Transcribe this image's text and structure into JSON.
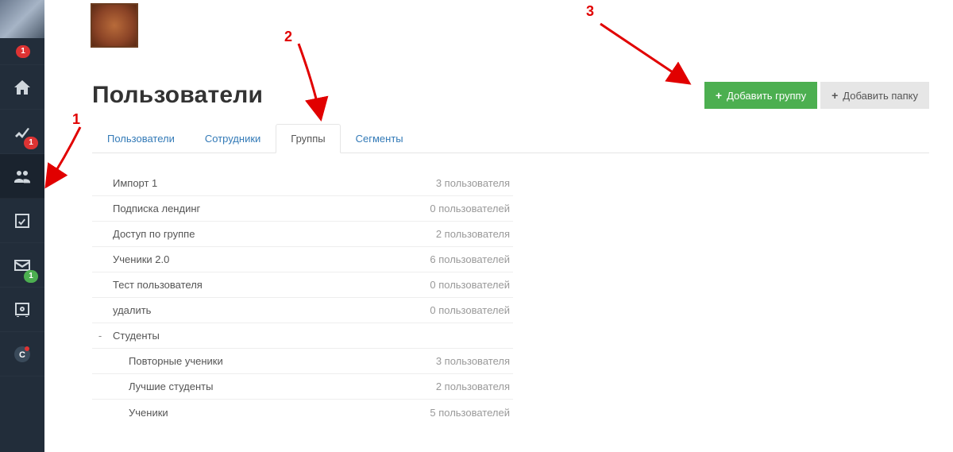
{
  "sidebar": {
    "items": [
      {
        "name": "avatar",
        "icon": "avatar",
        "badge": null
      },
      {
        "name": "badge-only",
        "icon": "none",
        "badge": {
          "text": "1",
          "color": "red"
        }
      },
      {
        "name": "home",
        "icon": "home",
        "badge": null
      },
      {
        "name": "stats",
        "icon": "chart",
        "badge": {
          "text": "1",
          "color": "red"
        }
      },
      {
        "name": "users",
        "icon": "users",
        "badge": null,
        "active": true
      },
      {
        "name": "tasks",
        "icon": "check",
        "badge": null
      },
      {
        "name": "mail",
        "icon": "mail",
        "badge": {
          "text": "1",
          "color": "green"
        }
      },
      {
        "name": "vault",
        "icon": "safe",
        "badge": null
      },
      {
        "name": "chat",
        "icon": "chat",
        "badge": null
      }
    ]
  },
  "header": {
    "page_title": "Пользователи",
    "actions": {
      "add_group_label": "Добавить группу",
      "add_folder_label": "Добавить папку"
    }
  },
  "tabs": [
    {
      "label": "Пользователи",
      "active": false
    },
    {
      "label": "Сотрудники",
      "active": false
    },
    {
      "label": "Группы",
      "active": true
    },
    {
      "label": "Сегменты",
      "active": false
    }
  ],
  "groups": [
    {
      "label": "Импорт 1",
      "count_text": "3 пользователя"
    },
    {
      "label": "Подписка лендинг",
      "count_text": "0 пользователей"
    },
    {
      "label": "Доступ по группе",
      "count_text": "2 пользователя"
    },
    {
      "label": "Ученики 2.0",
      "count_text": "6 пользователей"
    },
    {
      "label": "Тест пользователя",
      "count_text": "0 пользователей"
    },
    {
      "label": "удалить",
      "count_text": "0 пользователей"
    }
  ],
  "folder": {
    "toggle": "-",
    "label": "Студенты",
    "children": [
      {
        "label": "Повторные ученики",
        "count_text": "3 пользователя"
      },
      {
        "label": "Лучшие студенты",
        "count_text": "2 пользователя"
      },
      {
        "label": "Ученики",
        "count_text": "5 пользователей"
      }
    ]
  },
  "annotations": {
    "n1": "1",
    "n2": "2",
    "n3": "3"
  }
}
